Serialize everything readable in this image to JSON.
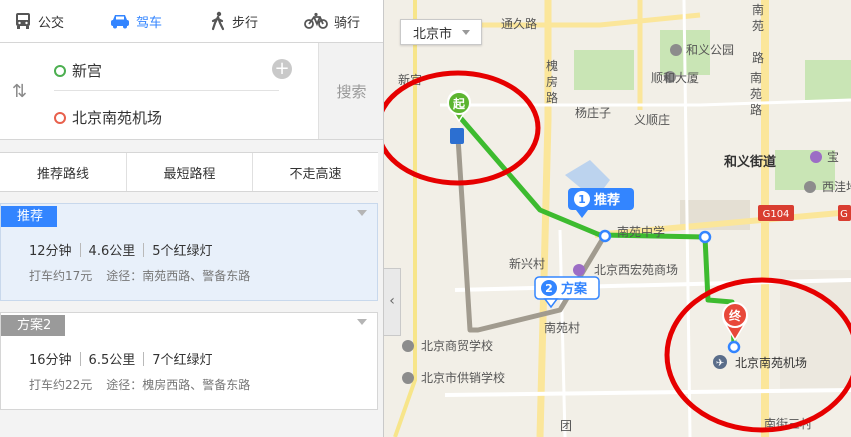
{
  "modes": {
    "bus": "公交",
    "drive": "驾车",
    "walk": "步行",
    "bike": "骑行"
  },
  "route": {
    "start": "新宫",
    "end": "北京南苑机场",
    "search_label": "搜索"
  },
  "tabs": [
    "推荐路线",
    "最短路程",
    "不走高速"
  ],
  "plans": [
    {
      "tag": "推荐",
      "time": "12分钟",
      "distance": "4.6公里",
      "lights": "5个红绿灯",
      "taxi": "打车约17元",
      "via": "途径：南苑西路、警备东路"
    },
    {
      "tag": "方案2",
      "time": "16分钟",
      "distance": "6.5公里",
      "lights": "7个红绿灯",
      "taxi": "打车约22元",
      "via": "途径：槐房西路、警备东路"
    }
  ],
  "map": {
    "city": "北京市",
    "start_marker": "起",
    "end_marker": "终",
    "callout_1_num": "1",
    "callout_1_label": "推荐",
    "callout_2_num": "2",
    "callout_2_label": "方案",
    "road_label": "G104",
    "labels": {
      "tongjiu": "通久路",
      "heyi_park": "和义公园",
      "nanyuan_rd": "南苑路",
      "huaifang": "槐房路",
      "xingong_partial": "新宫",
      "shunhe": "顺和大厦",
      "yangzhuangzi": "杨庄子",
      "yishunju": "义顺庄",
      "heyi_street": "和义街道",
      "baoxin": "宝",
      "xiwa": "西洼地",
      "xi": "西",
      "nanyuan_mid": "南苑中学",
      "xinxingcun": "新兴村",
      "xihong": "北京西宏苑商场",
      "nanyuancun": "南苑村",
      "shangmao": "北京商贸学校",
      "gongxiao": "北京市供销学校",
      "airport": "北京南苑机场",
      "tuan": "团",
      "nanjie": "南街三村"
    },
    "colors": {
      "route_primary": "#3dbb2f",
      "route_alt": "#a19b8f",
      "highlight_circle": "#e60000",
      "start_green": "#5cb531",
      "end_red": "#e8483a",
      "callout_blue": "#3385ff"
    }
  }
}
